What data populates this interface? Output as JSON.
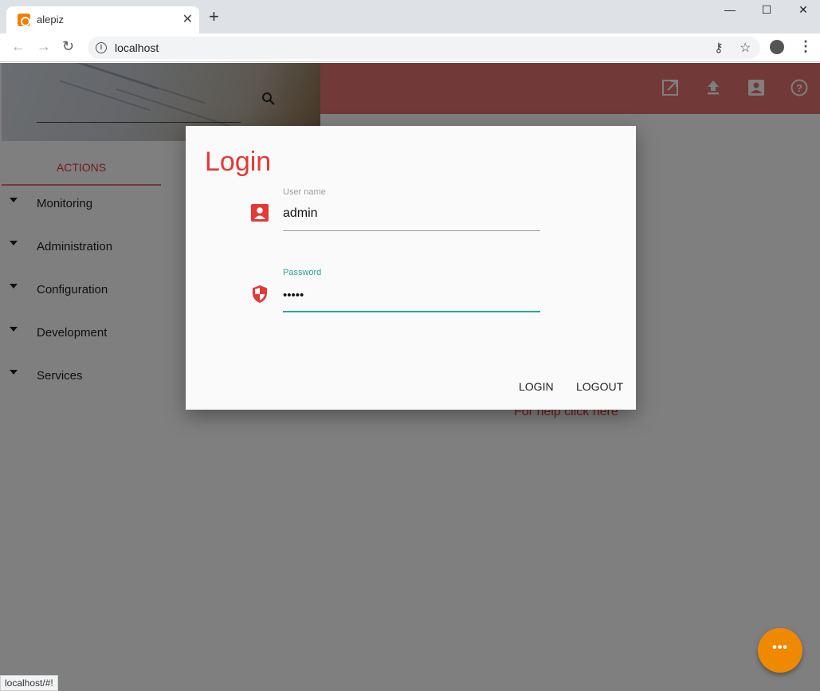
{
  "browser": {
    "tab_title": "alepiz",
    "tab_close": "✕",
    "new_tab": "+",
    "window_controls": [
      "—",
      "☐",
      "✕"
    ],
    "url": "localhost",
    "status_url": "localhost/#!"
  },
  "sidebar": {
    "actions_label": "ACTIONS",
    "items": [
      {
        "label": "Monitoring"
      },
      {
        "label": "Administration"
      },
      {
        "label": "Configuration"
      },
      {
        "label": "Development"
      },
      {
        "label": "Services"
      }
    ]
  },
  "content": {
    "help_link": "For help click here"
  },
  "login": {
    "title": "Login",
    "username_label": "User name",
    "username_value": "admin",
    "password_label": "Password",
    "password_value": "•••••",
    "login_button": "LOGIN",
    "logout_button": "LOGOUT"
  },
  "fab": {
    "label": "•••"
  },
  "colors": {
    "accent_red": "#e53935",
    "appbar": "#e57373",
    "teal": "#26a69a",
    "fab": "#ef8a00"
  },
  "icons": {
    "appbar": [
      "open-in-new-icon",
      "upload-icon",
      "account-box-icon",
      "help-icon"
    ],
    "username_field": "account-box-icon",
    "password_field": "security-shield-icon"
  }
}
